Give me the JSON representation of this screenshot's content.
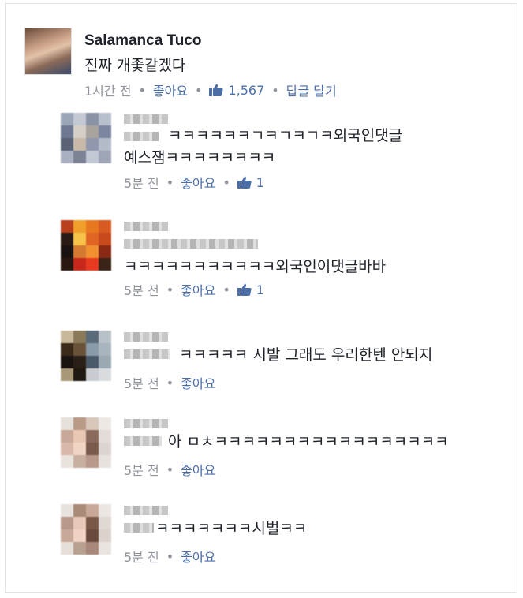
{
  "post": {
    "author": "Salamanca Tuco",
    "text": "진짜 개좇같겠다",
    "time": "1시간 전",
    "like_label": "좋아요",
    "like_count": "1,567",
    "reply_label": "답글 달기"
  },
  "comments": [
    {
      "line1": "ㅋㅋㅋㅋㅋㅋㄱㅋㄱㅋㄱㅋ외국인댓글",
      "line2": "예스잼ㅋㅋㅋㅋㅋㅋㅋㅋ",
      "time": "5분 전",
      "like_label": "좋아요",
      "like_count": "1"
    },
    {
      "line1": "ㅋㅋㅋㅋㅋㅋㅋㅋㅋㅋㅋ외국인이댓글바바",
      "time": "5분 전",
      "like_label": "좋아요",
      "like_count": "1"
    },
    {
      "line1": "ㅋㅋㅋㅋㅋ 시발 그래도 우리한텐 안되지",
      "time": "5분 전",
      "like_label": "좋아요"
    },
    {
      "line1": "아 ㅁㅊㅋㅋㅋㅋㅋㅋㅋㅋㅋㅋㅋㅋㅋㅋㅋㅋㅋ",
      "time": "5분 전",
      "like_label": "좋아요"
    },
    {
      "line1": "ㅋㅋㅋㅋㅋㅋㅋ시벌ㅋㅋ",
      "time": "5분 전",
      "like_label": "좋아요"
    }
  ],
  "colors": {
    "link": "#4b6ea9",
    "meta": "#90949c",
    "text": "#1d2129"
  },
  "icons": {
    "like": "thumbs-up-icon"
  }
}
